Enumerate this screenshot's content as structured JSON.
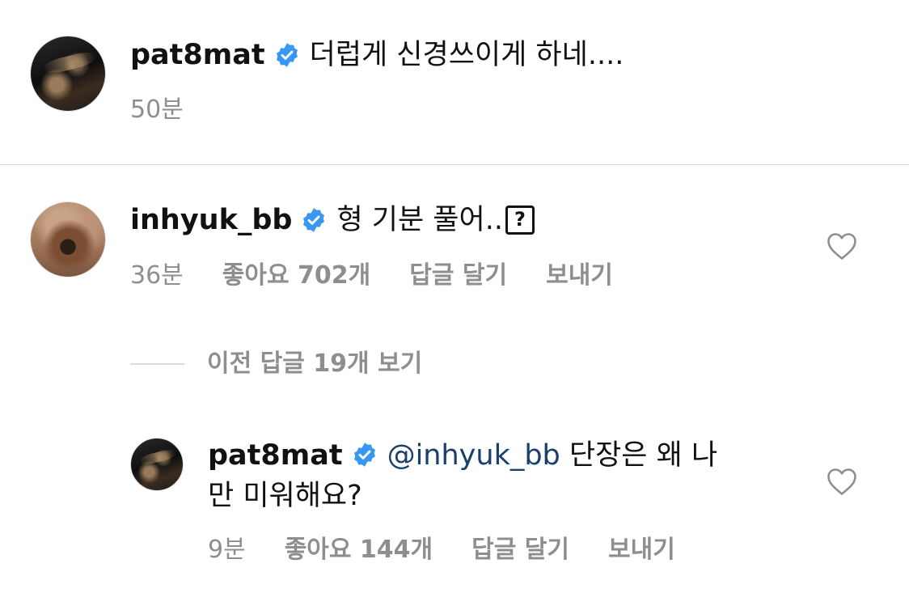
{
  "caption": {
    "username": "pat8mat",
    "verified": true,
    "text": "더럽게 신경쓰이게 하네....",
    "time": "50분"
  },
  "comment": {
    "username": "inhyuk_bb",
    "verified": true,
    "text": "형 기분 풀어..",
    "emoji_placeholder": "?",
    "time": "36분",
    "likes": "좋아요 702개",
    "reply_label": "답글 달기",
    "send_label": "보내기",
    "view_replies": "이전 답글 19개 보기"
  },
  "reply": {
    "username": "pat8mat",
    "verified": true,
    "mention": "@inhyuk_bb",
    "text_line1": "단장은 왜 나",
    "text_line2": "만 미워해요?",
    "time": "9분",
    "likes": "좋아요 144개",
    "reply_label": "답글 달기",
    "send_label": "보내기"
  },
  "colors": {
    "verified": "#3897f0",
    "mention": "#1a3f6b",
    "secondary_text": "#8e8e8e",
    "divider": "#dbdbdb"
  },
  "icons": {
    "verified": "verified-badge-icon",
    "like": "heart-outline-icon"
  }
}
